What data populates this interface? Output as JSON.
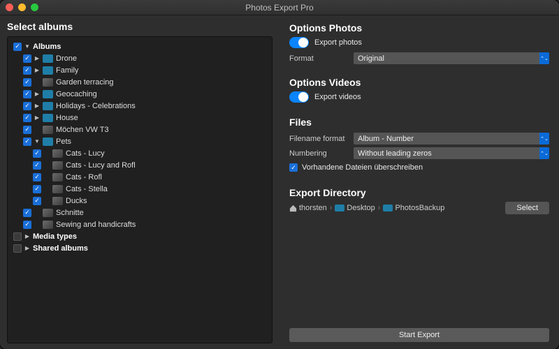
{
  "window": {
    "title": "Photos Export Pro"
  },
  "left": {
    "heading": "Select albums",
    "tree": [
      {
        "level": 0,
        "checked": true,
        "disclosure": "down",
        "icon": "none",
        "label": "Albums",
        "bold": true
      },
      {
        "level": 1,
        "checked": true,
        "disclosure": "right",
        "icon": "folder",
        "label": "Drone"
      },
      {
        "level": 1,
        "checked": true,
        "disclosure": "right",
        "icon": "folder",
        "label": "Family"
      },
      {
        "level": 1,
        "checked": true,
        "disclosure": "none",
        "icon": "thumb",
        "label": "Garden terracing"
      },
      {
        "level": 1,
        "checked": true,
        "disclosure": "right",
        "icon": "folder",
        "label": "Geocaching"
      },
      {
        "level": 1,
        "checked": true,
        "disclosure": "right",
        "icon": "folder",
        "label": "Holidays - Celebrations"
      },
      {
        "level": 1,
        "checked": true,
        "disclosure": "right",
        "icon": "folder",
        "label": "House"
      },
      {
        "level": 1,
        "checked": true,
        "disclosure": "none",
        "icon": "thumb",
        "label": "Möchen VW T3"
      },
      {
        "level": 1,
        "checked": true,
        "disclosure": "down",
        "icon": "folder",
        "label": "Pets"
      },
      {
        "level": 2,
        "checked": true,
        "disclosure": "none",
        "icon": "thumb",
        "label": "Cats - Lucy"
      },
      {
        "level": 2,
        "checked": true,
        "disclosure": "none",
        "icon": "thumb",
        "label": "Cats - Lucy and Rofl"
      },
      {
        "level": 2,
        "checked": true,
        "disclosure": "none",
        "icon": "thumb",
        "label": "Cats - Rofl"
      },
      {
        "level": 2,
        "checked": true,
        "disclosure": "none",
        "icon": "thumb",
        "label": "Cats - Stella"
      },
      {
        "level": 2,
        "checked": true,
        "disclosure": "none",
        "icon": "thumb",
        "label": "Ducks"
      },
      {
        "level": 1,
        "checked": true,
        "disclosure": "none",
        "icon": "thumb",
        "label": "Schnitte"
      },
      {
        "level": 1,
        "checked": true,
        "disclosure": "none",
        "icon": "thumb",
        "label": "Sewing and handicrafts"
      },
      {
        "level": 0,
        "checked": false,
        "disclosure": "right",
        "icon": "none",
        "label": "Media types",
        "bold": true
      },
      {
        "level": 0,
        "checked": false,
        "disclosure": "right",
        "icon": "none",
        "label": "Shared albums",
        "bold": true
      }
    ]
  },
  "right": {
    "photos": {
      "heading": "Options Photos",
      "toggle_label": "Export photos",
      "toggle_on": true,
      "format_label": "Format",
      "format_value": "Original"
    },
    "videos": {
      "heading": "Options Videos",
      "toggle_label": "Export videos",
      "toggle_on": true
    },
    "files": {
      "heading": "Files",
      "filename_label": "Filename format",
      "filename_value": "Album - Number",
      "numbering_label": "Numbering",
      "numbering_value": "Without leading zeros",
      "overwrite_label": "Vorhandene Dateien überschreiben",
      "overwrite_checked": true
    },
    "directory": {
      "heading": "Export Directory",
      "segments": [
        "thorsten",
        "Desktop",
        "PhotosBackup"
      ],
      "select_button": "Select"
    },
    "start_button": "Start Export"
  }
}
